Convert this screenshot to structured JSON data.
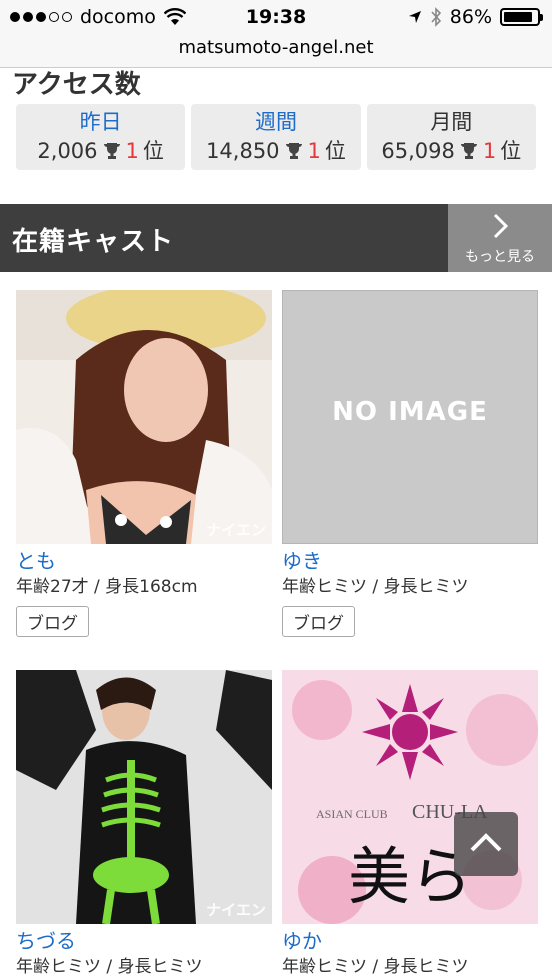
{
  "status_bar": {
    "carrier": "docomo",
    "time": "19:38",
    "battery": "86%",
    "battery_level": 0.86
  },
  "browser": {
    "url": "matsumoto-angel.net"
  },
  "access": {
    "title": "アクセス数",
    "stats": [
      {
        "label": "昨日",
        "count": "2,006",
        "rank": "1",
        "rank_suffix": "位"
      },
      {
        "label": "週間",
        "count": "14,850",
        "rank": "1",
        "rank_suffix": "位"
      },
      {
        "label": "月間",
        "count": "65,098",
        "rank": "1",
        "rank_suffix": "位"
      }
    ]
  },
  "cast": {
    "title": "在籍キャスト",
    "more_label": "もっと見る",
    "members": [
      {
        "name": "とも",
        "info": "年齢27才 / 身長168cm",
        "blog_label": "ブログ",
        "watermark": "ナイエン"
      },
      {
        "name": "ゆき",
        "info": "年齢ヒミツ / 身長ヒミツ",
        "blog_label": "ブログ",
        "placeholder": "NO IMAGE"
      },
      {
        "name": "ちづる",
        "info": "年齢ヒミツ / 身長ヒミツ",
        "watermark": "ナイエン"
      },
      {
        "name": "ゆか",
        "info": "年齢ヒミツ / 身長ヒミツ",
        "logo_brand": "ASIAN CLUB",
        "logo_name": "CHU-LA",
        "logo_kanji": "美ら"
      }
    ]
  },
  "colors": {
    "link": "#1e6cc9",
    "rank": "#e53939",
    "header_bg": "#3e3e3e",
    "more_bg": "#8b8b8b"
  }
}
